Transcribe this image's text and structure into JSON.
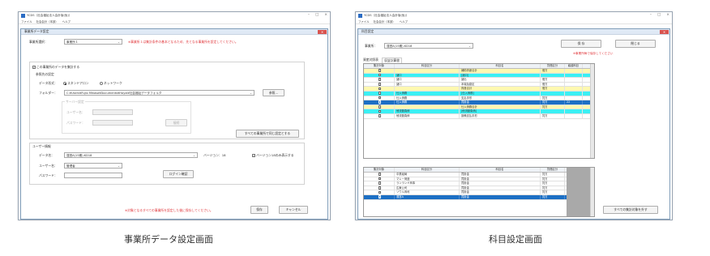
{
  "left": {
    "app_title": "YCDS（社会福祉法人会計版(仮)）",
    "menu": [
      "ファイル",
      "社会会計（本部）",
      "ヘルプ"
    ],
    "dialog_title": "事業所データ設定",
    "office_label": "事業所選択：",
    "office_value": "事業所１",
    "office_warning": "※事業所１は集計条件の基本となるため、先となる事業所を設定してください。",
    "use_data_label": "この事業所のデータを集計する",
    "ref_section": "参照先の設定",
    "data_format_label": "データ形式：",
    "radio_standalone": "スタンドアロン",
    "radio_network": "ネットワーク",
    "folder_label": "フォルダー：",
    "folder_value": "C:¥Users¥Fujio Mikasa¥Documents¥Hayai¥社会福祉データフォルダ",
    "browse_button": "参照...",
    "server_section": "サーバー設定",
    "user_name_label": "ユーザー名：",
    "password_label": "パスワード：",
    "connect_button": "接続",
    "apply_all_button": "すべての事業所で同じ設定とする",
    "user_info_section": "ユーザー情報",
    "data_name_label": "データ名：",
    "data_name_value": "運営A(15期).KD18",
    "version_label": "バージョン：18",
    "version_only_label": "バージョン18のみ表示する",
    "user_label": "ユーザー名：",
    "user_value": "管理者",
    "pass_label": "パスワード：",
    "login_button": "ログイン確認",
    "footer_warning": "※対象となるすべての事業所を設定した後に保存してください。",
    "save_button": "保存",
    "cancel_button": "キャンセル",
    "caption": "事業所データ設定画面"
  },
  "right": {
    "app_title": "YCDS（社会福祉法人会計版(仮)）",
    "menu": [
      "ファイル",
      "社会会計（本部）",
      "ヘルプ"
    ],
    "dialog_title": "科目設定",
    "office_label": "事業所：",
    "office_value": "運営A(15期).KD18",
    "save_button": "保 存",
    "close_button": "閉じる",
    "save_note": "※事業所毎で保存してください",
    "tabs": [
      "資産対照表",
      "収益計算書"
    ],
    "columns": [
      "集計対象",
      "科目区分",
      "科目名",
      "貸借区分",
      "繰越科目"
    ],
    "rows": [
      {
        "style": "y",
        "check": false,
        "cat": "",
        "name": "補助資産合計",
        "side": "借方",
        "carry": ""
      },
      {
        "style": "c",
        "check": false,
        "cat": "諸口",
        "name": "[諸口]",
        "side": "",
        "carry": ""
      },
      {
        "style": "",
        "check": false,
        "cat": "諸口",
        "name": "諸出",
        "side": "借方",
        "carry": ""
      },
      {
        "style": "",
        "check": false,
        "cat": "諸口",
        "name": "本端及勘定",
        "side": "借方",
        "carry": ""
      },
      {
        "style": "y",
        "check": false,
        "cat": "",
        "name": "資産合計",
        "side": "借方",
        "carry": ""
      },
      {
        "style": "c",
        "check": false,
        "cat": "仕入債務",
        "name": "[仕入債務]",
        "side": "",
        "carry": ""
      },
      {
        "style": "",
        "check": false,
        "cat": "仕入債務",
        "name": "支払手形",
        "side": "貸方",
        "carry": ""
      },
      {
        "style": "s",
        "check": false,
        "cat": "仕入債務",
        "name": "買掛金",
        "side": "貸方",
        "carry": "22"
      },
      {
        "style": "y",
        "check": false,
        "cat": "",
        "name": "仕入債務合計",
        "side": "貸方",
        "carry": ""
      },
      {
        "style": "c",
        "check": false,
        "cat": "他流動負債",
        "name": "[他流動負債]",
        "side": "",
        "carry": ""
      },
      {
        "style": "",
        "check": false,
        "cat": "他流動負債",
        "name": "設備支払手形",
        "side": "貸方",
        "carry": ""
      }
    ],
    "lower_columns": [
      "集計対象",
      "科目区分",
      "科目名",
      "貸借区分"
    ],
    "lower_rows": [
      {
        "style": "",
        "check": false,
        "cat": "中業組局",
        "name": "買掛金",
        "side": "貸方"
      },
      {
        "style": "",
        "check": false,
        "cat": "マレー荷造",
        "name": "買掛金",
        "side": "貸方"
      },
      {
        "style": "",
        "check": false,
        "cat": "ランランド商事",
        "name": "買掛金",
        "side": "貸方"
      },
      {
        "style": "",
        "check": false,
        "cat": "広東公司",
        "name": "買掛金",
        "side": "貸方"
      },
      {
        "style": "",
        "check": false,
        "cat": "ソウル商司",
        "name": "買掛金",
        "side": "貸方"
      },
      {
        "style": "s",
        "check": true,
        "cat": "運営A",
        "name": "買掛金",
        "side": "貸方"
      }
    ],
    "apply_all_button": "すべての集計対象を外す",
    "caption": "科目設定画面"
  }
}
